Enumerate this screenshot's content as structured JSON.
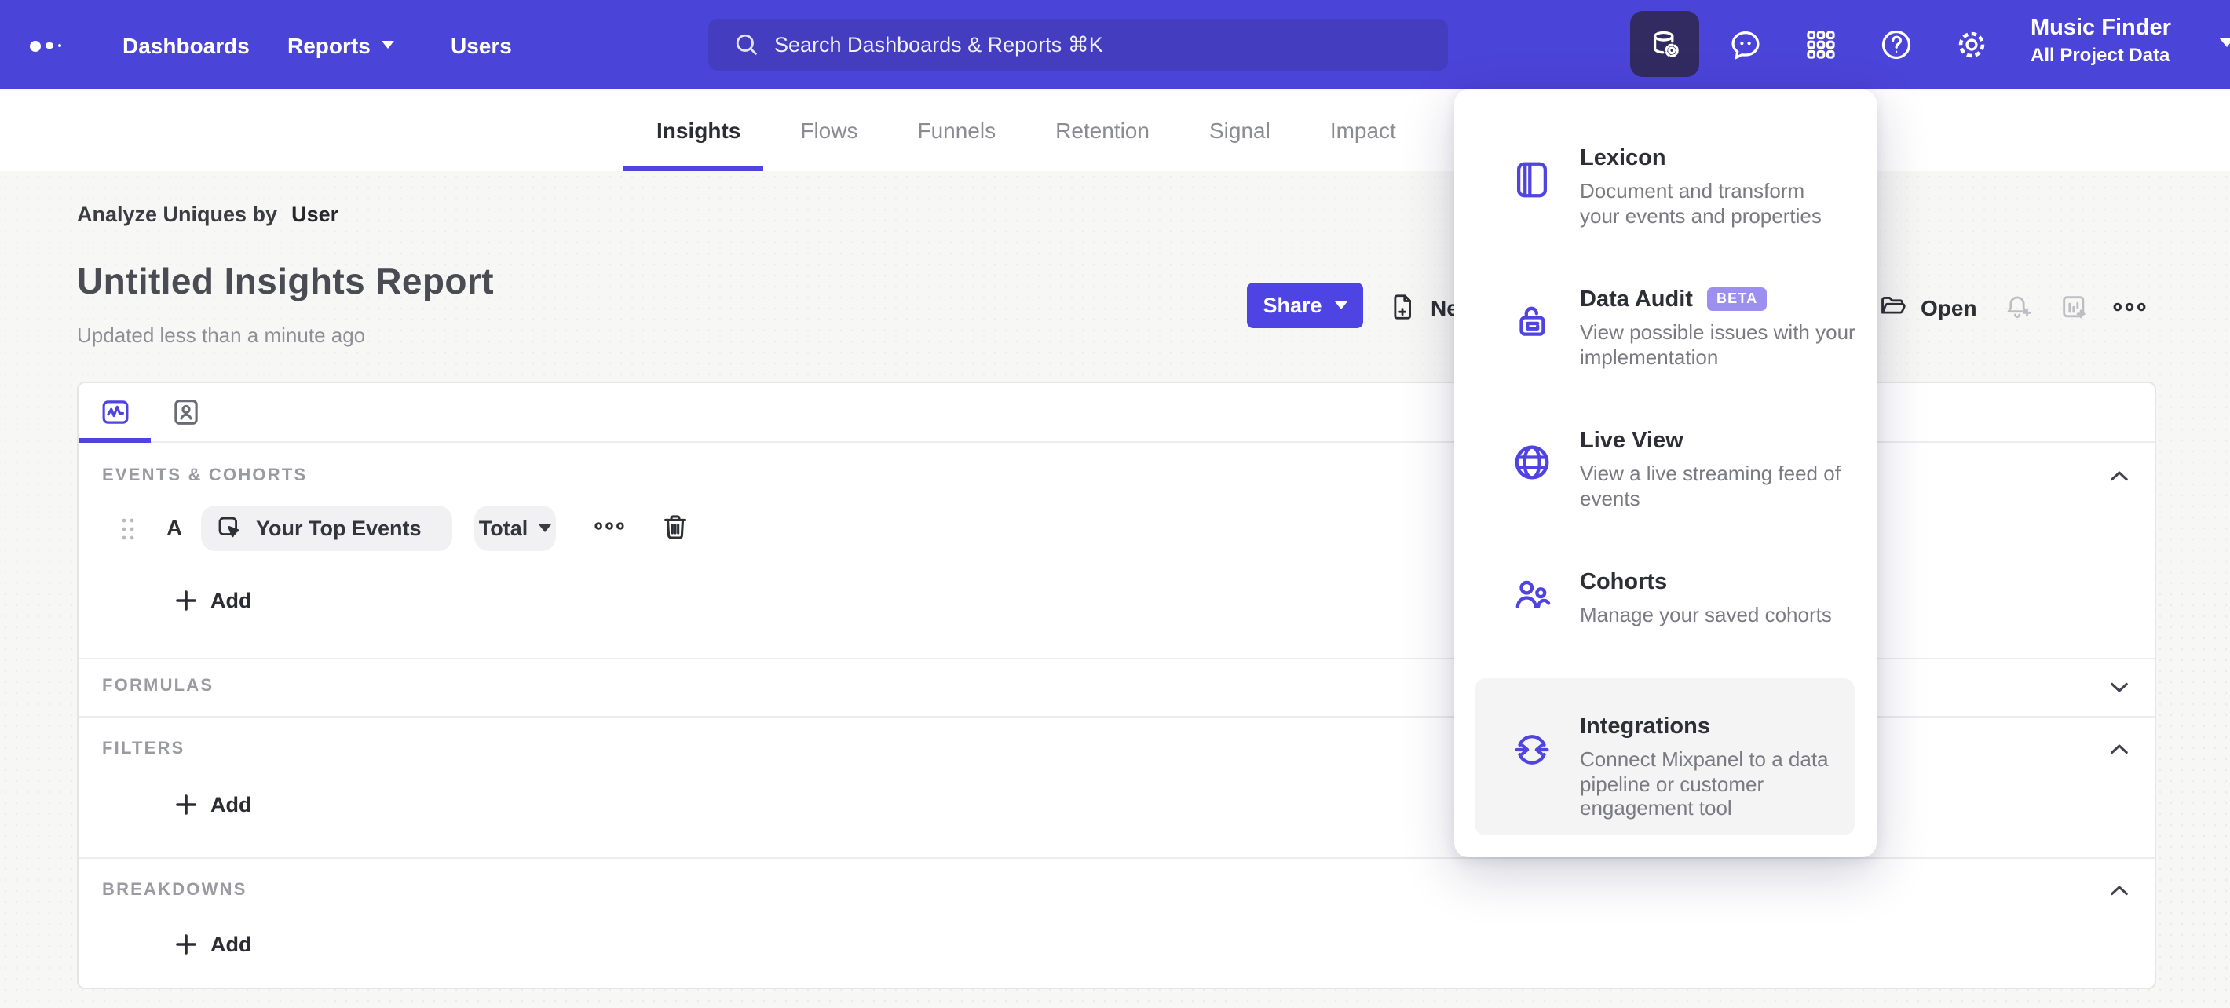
{
  "topnav": {
    "items": [
      {
        "label": "Dashboards"
      },
      {
        "label": "Reports"
      },
      {
        "label": "Users"
      }
    ],
    "search": {
      "placeholder": "Search Dashboards & Reports ⌘K"
    },
    "right_icons": [
      {
        "name": "data-management-icon",
        "active": true
      },
      {
        "name": "feedback-icon"
      },
      {
        "name": "apps-grid-icon"
      },
      {
        "name": "help-icon"
      },
      {
        "name": "settings-icon"
      }
    ],
    "project": {
      "name": "Music Finder",
      "scope": "All Project Data"
    }
  },
  "report_tabs": {
    "items": [
      "Insights",
      "Flows",
      "Funnels",
      "Retention",
      "Signal",
      "Impact"
    ],
    "active": "Insights"
  },
  "report_header": {
    "analyze_label": "Analyze Uniques by",
    "analyze_value": "User",
    "title": "Untitled Insights Report",
    "updated": "Updated less than a minute ago",
    "share": "Share",
    "new_partial": "Ne",
    "open": "Open"
  },
  "builder": {
    "events_label": "EVENTS & COHORTS",
    "series_letter": "A",
    "event_name": "Your Top Events",
    "metric": "Total",
    "add": "Add",
    "formulas_label": "FORMULAS",
    "filters_label": "FILTERS",
    "breakdowns_label": "BREAKDOWNS"
  },
  "data_menu": {
    "items": [
      {
        "title": "Lexicon",
        "desc": "Document and transform\nyour events and properties"
      },
      {
        "title": "Data Audit",
        "badge": "BETA",
        "desc": "View possible issues with your\nimplementation"
      },
      {
        "title": "Live View",
        "desc": "View a live streaming feed of\nevents"
      },
      {
        "title": "Cohorts",
        "desc": "Manage your saved cohorts"
      },
      {
        "title": "Integrations",
        "desc": "Connect Mixpanel to a data\npipeline or customer\nengagement tool",
        "highlighted": true
      }
    ]
  },
  "colors": {
    "header_purple": "#4b44d8",
    "search_purple": "#443dc0",
    "accent_purple": "#4f44e0",
    "share_purple": "#4e44e4",
    "beta_badge": "#9d8ff2",
    "active_tile": "#312b62",
    "page_bg": "#f7f7f5"
  }
}
